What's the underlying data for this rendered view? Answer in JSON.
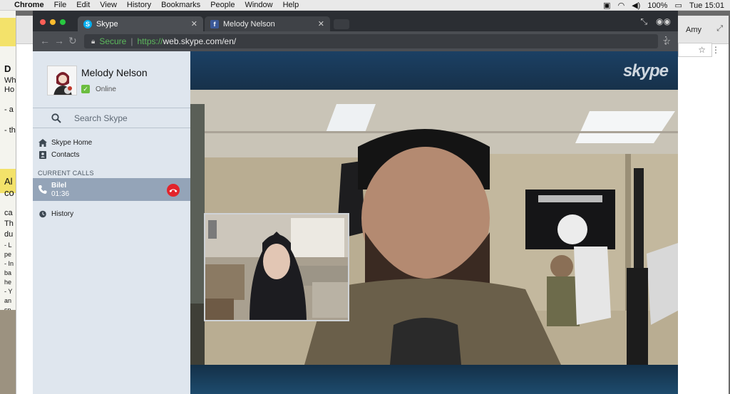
{
  "menubar": {
    "app": "Chrome",
    "items": [
      "File",
      "Edit",
      "View",
      "History",
      "Bookmarks",
      "People",
      "Window",
      "Help"
    ],
    "battery": "100%",
    "clock": "Tue 15:01"
  },
  "background_window": {
    "profile_name": "Amy",
    "left_text_fragments": [
      "D",
      "Wh",
      "Ho",
      "- a",
      "- th",
      "Al",
      "co",
      "ca",
      "Th",
      "du",
      "- L",
      "pe",
      "- In",
      "ba",
      "he",
      "- Y",
      "an",
      "sp"
    ]
  },
  "browser": {
    "tabs": [
      {
        "label": "Skype",
        "active": true,
        "icon": "skype-favicon"
      },
      {
        "label": "Melody Nelson",
        "active": false,
        "icon": "facebook-favicon"
      }
    ],
    "address": {
      "secure_label": "Secure",
      "scheme": "https://",
      "host_path": "web.skype.com/en/"
    }
  },
  "skype": {
    "profile": {
      "name": "Melody Nelson",
      "status": "Online"
    },
    "search_placeholder": "Search Skype",
    "nav": [
      {
        "label": "Skype Home",
        "icon": "home-icon"
      },
      {
        "label": "Contacts",
        "icon": "contacts-icon"
      }
    ],
    "current_calls_header": "CURRENT CALLS",
    "call": {
      "name": "Bilel",
      "duration": "01:36"
    },
    "history_label": "History",
    "logo_text": "skype"
  },
  "colors": {
    "skype_sidebar": "#dfe6ee",
    "active_call_row": "#94a4b8",
    "hangup_red": "#e3242b",
    "online_green": "#6bbd3f",
    "secure_green": "#5cb85c"
  }
}
